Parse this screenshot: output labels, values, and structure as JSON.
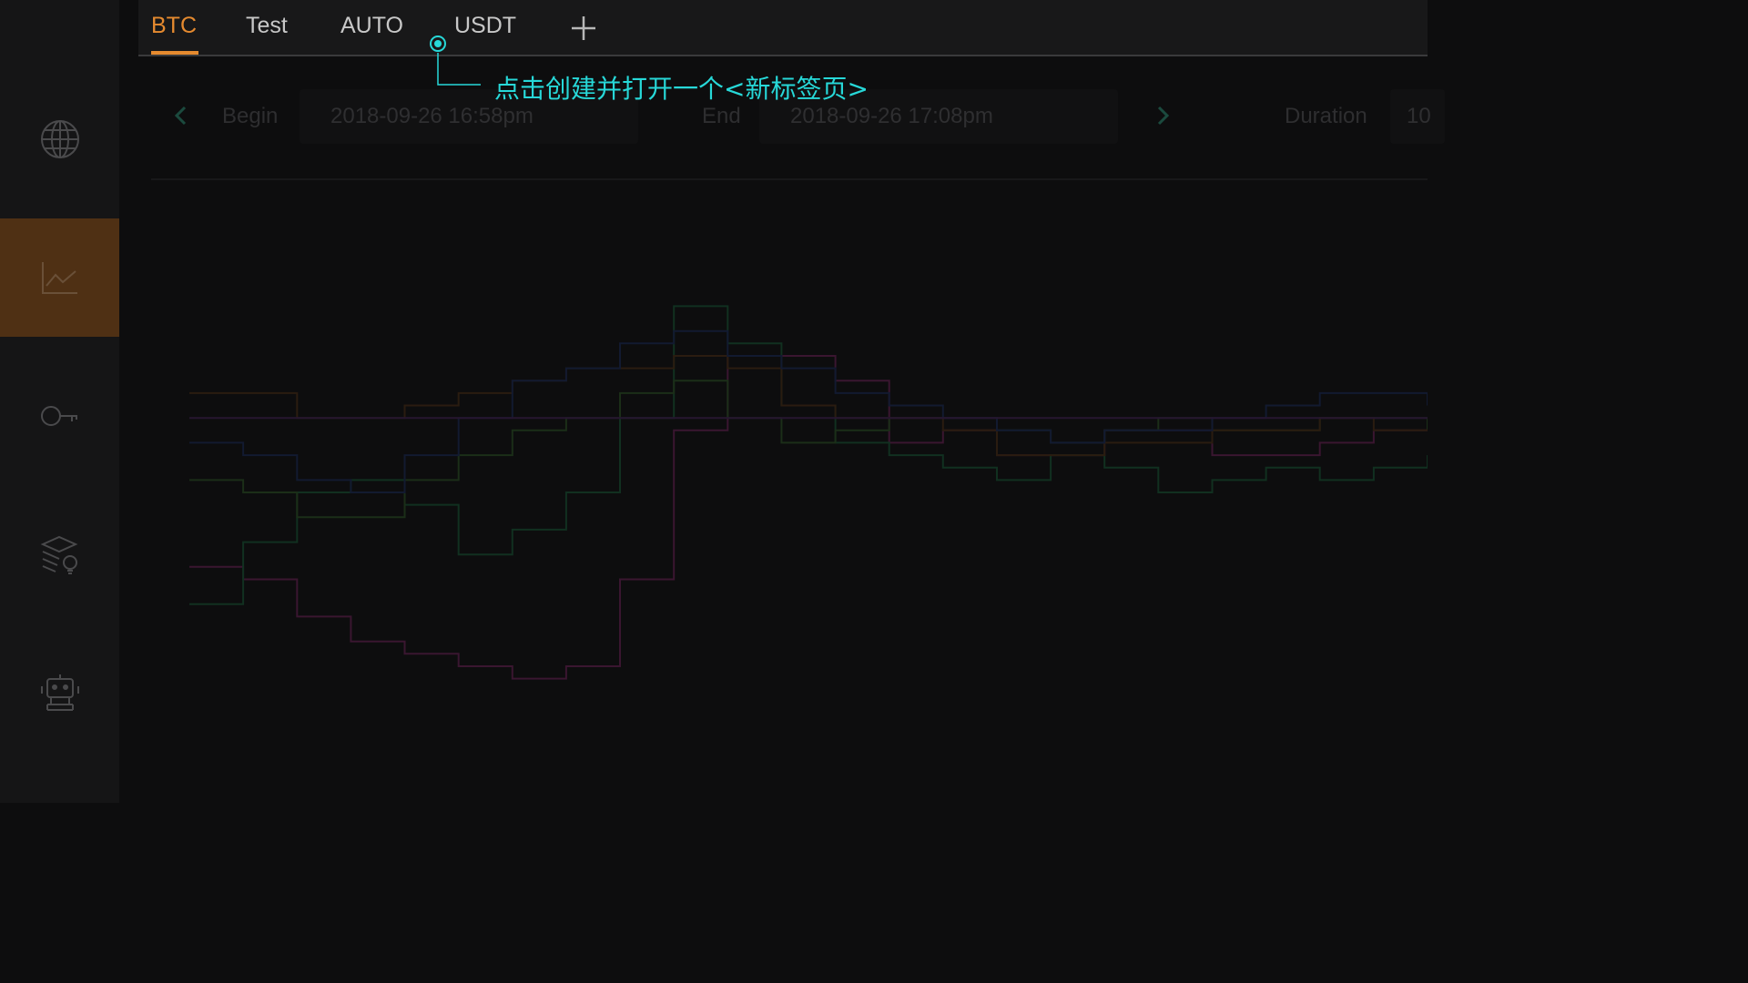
{
  "sidebar": {
    "items": [
      {
        "icon": "globe-icon",
        "active": false
      },
      {
        "icon": "line-chart-icon",
        "active": true
      },
      {
        "icon": "key-icon",
        "active": false
      },
      {
        "icon": "layers-lightbulb-icon",
        "active": false
      },
      {
        "icon": "robot-icon",
        "active": false
      }
    ]
  },
  "tabs": [
    {
      "label": "BTC",
      "active": true
    },
    {
      "label": "Test",
      "active": false
    },
    {
      "label": "AUTO",
      "active": false
    },
    {
      "label": "USDT",
      "active": false
    }
  ],
  "add_tab_icon": "plus-icon",
  "timebar": {
    "begin_label": "Begin",
    "begin_value": "2018-09-26 16:58pm",
    "end_label": "End",
    "end_value": "2018-09-26 17:08pm",
    "duration_label": "Duration",
    "duration_value": "10"
  },
  "hint": {
    "text": "点击创建并打开一个<新标签页>",
    "color": "#27d8d8"
  },
  "colors": {
    "accent": "#e58a2f",
    "active_sidebar_bg": "#4f3014"
  },
  "chart_data": {
    "type": "line",
    "series": [
      {
        "color": "#3a1630",
        "values": [
          0.38,
          0.36,
          0.3,
          0.26,
          0.24,
          0.22,
          0.2,
          0.22,
          0.36,
          0.6,
          0.72,
          0.72,
          0.68,
          0.58,
          0.6,
          0.56,
          0.56,
          0.6,
          0.6,
          0.56,
          0.56,
          0.58,
          0.6,
          0.6
        ]
      },
      {
        "color": "#113020",
        "values": [
          0.32,
          0.42,
          0.5,
          0.52,
          0.48,
          0.4,
          0.44,
          0.5,
          0.62,
          0.8,
          0.74,
          0.64,
          0.58,
          0.56,
          0.54,
          0.52,
          0.56,
          0.54,
          0.5,
          0.52,
          0.54,
          0.52,
          0.54,
          0.56
        ]
      },
      {
        "color": "#1b2e18",
        "values": [
          0.52,
          0.5,
          0.46,
          0.46,
          0.52,
          0.56,
          0.6,
          0.62,
          0.66,
          0.68,
          0.62,
          0.58,
          0.6,
          0.62,
          0.62,
          0.6,
          0.58,
          0.6,
          0.62,
          0.6,
          0.6,
          0.62,
          0.62,
          0.6
        ]
      },
      {
        "color": "#2a1c10",
        "values": [
          0.66,
          0.66,
          0.62,
          0.62,
          0.64,
          0.66,
          0.68,
          0.7,
          0.7,
          0.72,
          0.7,
          0.64,
          0.62,
          0.62,
          0.6,
          0.56,
          0.56,
          0.58,
          0.58,
          0.6,
          0.6,
          0.62,
          0.6,
          0.6
        ]
      },
      {
        "color": "#121a30",
        "values": [
          0.58,
          0.56,
          0.52,
          0.5,
          0.56,
          0.62,
          0.68,
          0.7,
          0.74,
          0.76,
          0.72,
          0.7,
          0.66,
          0.64,
          0.62,
          0.6,
          0.58,
          0.6,
          0.6,
          0.62,
          0.64,
          0.66,
          0.66,
          0.64
        ]
      },
      {
        "color": "#261630",
        "values": [
          0.62,
          0.62,
          0.62,
          0.62,
          0.62,
          0.62,
          0.62,
          0.62,
          0.62,
          0.62,
          0.62,
          0.62,
          0.62,
          0.62,
          0.62,
          0.62,
          0.62,
          0.62,
          0.62,
          0.62,
          0.62,
          0.62,
          0.62,
          0.62
        ]
      }
    ]
  }
}
